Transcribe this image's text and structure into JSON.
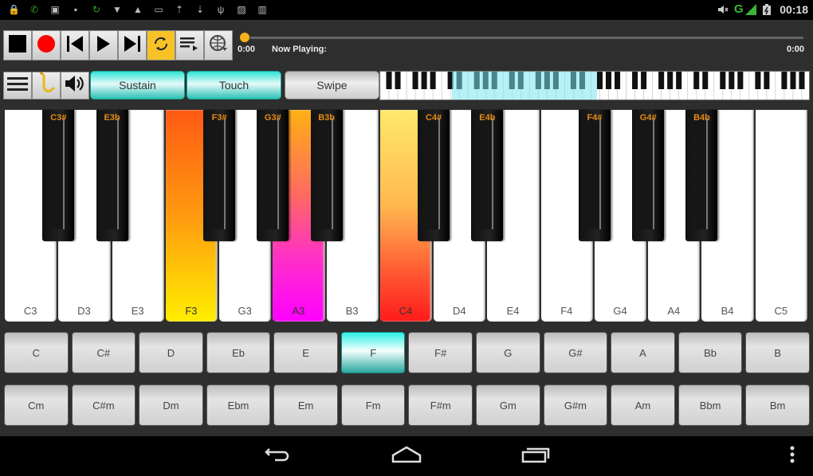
{
  "status_bar": {
    "left_icons": [
      "lock-icon",
      "phone-icon",
      "bbm-icon",
      "media-icon",
      "sync-icon",
      "shield-icon",
      "warning-icon",
      "chat-icon",
      "upload-icon",
      "download-icon",
      "usb-icon",
      "image-icon",
      "book-icon"
    ],
    "right_icons": [
      "mute-icon",
      "signal-icon",
      "battery-icon"
    ],
    "network": "G",
    "time": "00:18"
  },
  "transport": {
    "buttons": [
      "stop",
      "record",
      "previous",
      "play",
      "next",
      "loop",
      "playlist",
      "globe"
    ],
    "active": "loop",
    "record_color": "#ff0000",
    "active_color": "#f6c227",
    "time_start": "0:00",
    "now_playing_label": "Now Playing:",
    "time_end": "0:00",
    "progress": 0
  },
  "toolbar": {
    "menu_label": "menu",
    "instrument": "saxophone",
    "sound": "speaker",
    "modes": [
      {
        "label": "Sustain",
        "on": true
      },
      {
        "label": "Touch",
        "on": true
      },
      {
        "label": "Swipe",
        "on": false
      }
    ]
  },
  "mini_keyboard": {
    "highlight_color": "#7ee6f0"
  },
  "keyboard": {
    "white_keys": [
      {
        "note": "C3",
        "color": null
      },
      {
        "note": "D3",
        "color": null
      },
      {
        "note": "E3",
        "color": null
      },
      {
        "note": "F3",
        "color": "linear-gradient(#ff5a14 0%, #ff9a10 50%, #ffee00 100%)"
      },
      {
        "note": "G3",
        "color": null
      },
      {
        "note": "A3",
        "color": "linear-gradient(#ffb014 0%, #ff6a60 40%, #ff30c8 70%, #ff00ff 100%)"
      },
      {
        "note": "B3",
        "color": null
      },
      {
        "note": "C4",
        "color": "linear-gradient(#ffe96a 0%, #ffb850 45%, #ff5030 80%, #ff1a1a 100%)"
      },
      {
        "note": "D4",
        "color": null
      },
      {
        "note": "E4",
        "color": null
      },
      {
        "note": "F4",
        "color": null
      },
      {
        "note": "G4",
        "color": null
      },
      {
        "note": "A4",
        "color": null
      },
      {
        "note": "B4",
        "color": null
      },
      {
        "note": "C5",
        "color": null
      }
    ],
    "black_keys": [
      {
        "note": "C3#",
        "after": 0
      },
      {
        "note": "E3b",
        "after": 1
      },
      {
        "note": "F3#",
        "after": 3
      },
      {
        "note": "G3#",
        "after": 4
      },
      {
        "note": "B3b",
        "after": 5
      },
      {
        "note": "C4#",
        "after": 7
      },
      {
        "note": "E4b",
        "after": 8
      },
      {
        "note": "F4#",
        "after": 10
      },
      {
        "note": "G4#",
        "after": 11
      },
      {
        "note": "B4b",
        "after": 12
      }
    ]
  },
  "chords": {
    "major": [
      "C",
      "C#",
      "D",
      "Eb",
      "E",
      "F",
      "F#",
      "G",
      "G#",
      "A",
      "Bb",
      "B"
    ],
    "minor": [
      "Cm",
      "C#m",
      "Dm",
      "Ebm",
      "Em",
      "Fm",
      "F#m",
      "Gm",
      "G#m",
      "Am",
      "Bbm",
      "Bm"
    ],
    "selected": "F"
  },
  "nav_bar": {
    "buttons": [
      "back",
      "home",
      "recents",
      "overflow"
    ]
  }
}
